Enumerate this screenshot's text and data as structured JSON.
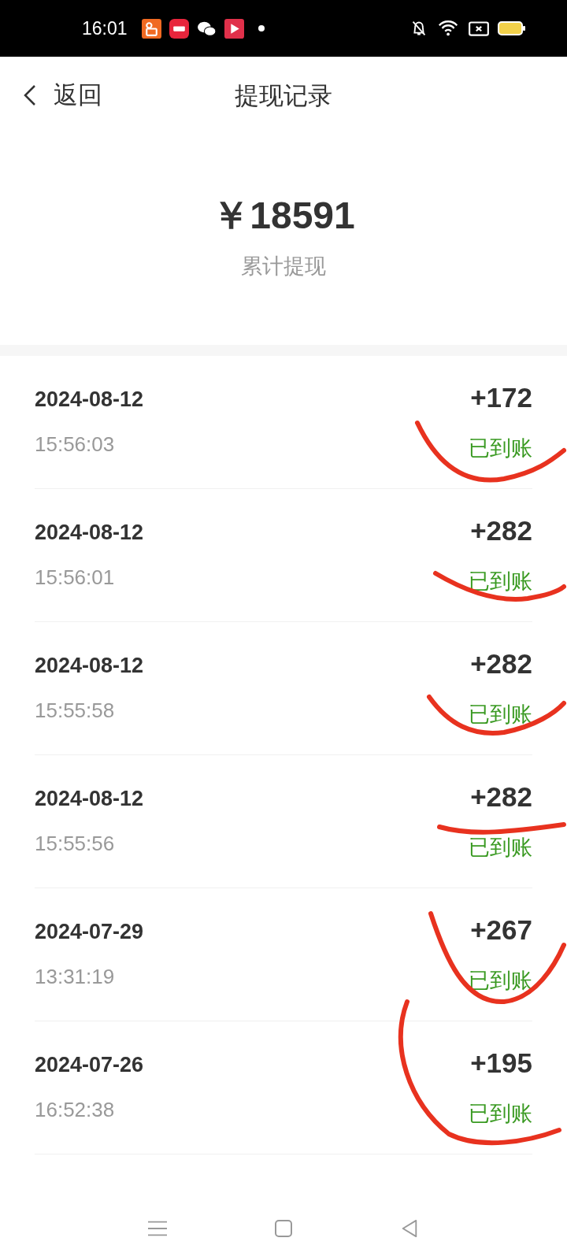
{
  "status_bar": {
    "time": "16:01"
  },
  "header": {
    "back_label": "返回",
    "title": "提现记录"
  },
  "summary": {
    "amount": "￥18591",
    "label": "累计提现"
  },
  "records": [
    {
      "date": "2024-08-12",
      "time": "15:56:03",
      "amount": "+172",
      "status": "已到账"
    },
    {
      "date": "2024-08-12",
      "time": "15:56:01",
      "amount": "+282",
      "status": "已到账"
    },
    {
      "date": "2024-08-12",
      "time": "15:55:58",
      "amount": "+282",
      "status": "已到账"
    },
    {
      "date": "2024-08-12",
      "time": "15:55:56",
      "amount": "+282",
      "status": "已到账"
    },
    {
      "date": "2024-07-29",
      "time": "13:31:19",
      "amount": "+267",
      "status": "已到账"
    },
    {
      "date": "2024-07-26",
      "time": "16:52:38",
      "amount": "+195",
      "status": "已到账"
    }
  ]
}
